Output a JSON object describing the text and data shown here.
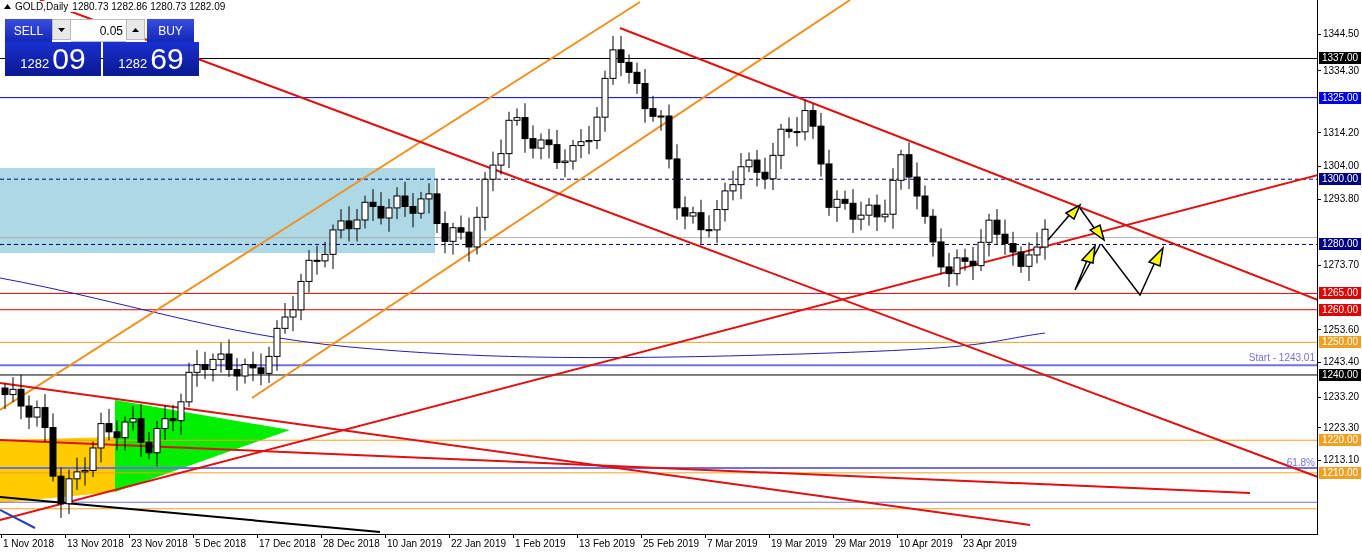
{
  "symbol_header": {
    "title": "GOLD,Daily",
    "ohlc": "1280.73 1282.86 1280.73 1282.09"
  },
  "trade_panel": {
    "sell_label": "SELL",
    "lot_field": {
      "value": "0.05"
    },
    "buy_label": "BUY",
    "sell_price": {
      "prefix": "1282",
      "pips": "09"
    },
    "buy_price": {
      "prefix": "1282",
      "pips": "69"
    }
  },
  "level_labels": [
    {
      "kind": "start",
      "text": "Start - 1243.01"
    },
    {
      "kind": "fib",
      "text": "61.8%"
    }
  ],
  "price_axis": {
    "ticks": [
      "1344.50",
      "1334.30",
      "1314.20",
      "1304.00",
      "1293.80",
      "1273.70",
      "1253.60",
      "1243.40",
      "1233.20",
      "1223.30",
      "1213.10"
    ],
    "tags": [
      {
        "text": "1337.00",
        "color": "#000000"
      },
      {
        "text": "1325.00",
        "color": "#0000e0"
      },
      {
        "text": "1300.00",
        "color": "#000080"
      },
      {
        "text": "1280.00",
        "color": "#000080"
      },
      {
        "text": "1265.00",
        "color": "#e00000"
      },
      {
        "text": "1260.00",
        "color": "#e00000"
      },
      {
        "text": "1250.00",
        "color": "#f0a020"
      },
      {
        "text": "1240.00",
        "color": "#000000"
      },
      {
        "text": "1220.00",
        "color": "#f0a020"
      },
      {
        "text": "1210.00",
        "color": "#f0a020"
      }
    ]
  },
  "time_axis": {
    "labels": [
      "1 Nov 2018",
      "13 Nov 2018",
      "23 Nov 2018",
      "5 Dec 2018",
      "17 Dec 2018",
      "28 Dec 2018",
      "10 Jan 2019",
      "22 Jan 2019",
      "1 Feb 2019",
      "13 Feb 2019",
      "25 Feb 2019",
      "7 Mar 2019",
      "19 Mar 2019",
      "29 Mar 2019",
      "10 Apr 2019",
      "23 Apr 2019"
    ]
  }
}
